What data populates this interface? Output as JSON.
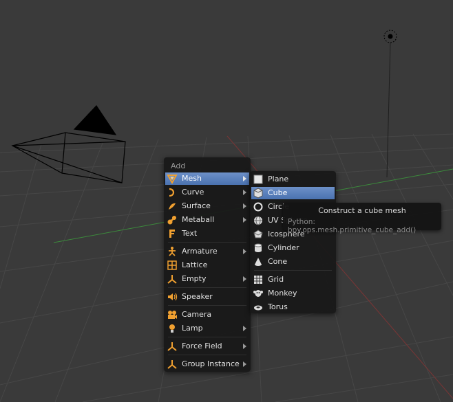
{
  "add_menu": {
    "title": "Add",
    "items": [
      {
        "label": "Mesh",
        "icon": "mesh-icon",
        "submenu": true,
        "active": true
      },
      {
        "label": "Curve",
        "icon": "curve-icon",
        "submenu": true
      },
      {
        "label": "Surface",
        "icon": "surface-icon",
        "submenu": true
      },
      {
        "label": "Metaball",
        "icon": "metaball-icon",
        "submenu": true
      },
      {
        "label": "Text",
        "icon": "text-icon",
        "submenu": false
      },
      {
        "label": "Armature",
        "icon": "armature-icon",
        "submenu": true
      },
      {
        "label": "Lattice",
        "icon": "lattice-icon",
        "submenu": false
      },
      {
        "label": "Empty",
        "icon": "empty-icon",
        "submenu": true
      },
      {
        "label": "Speaker",
        "icon": "speaker-icon",
        "submenu": false
      },
      {
        "label": "Camera",
        "icon": "camera-icon",
        "submenu": false
      },
      {
        "label": "Lamp",
        "icon": "lamp-icon",
        "submenu": true
      },
      {
        "label": "Force Field",
        "icon": "force-field-icon",
        "submenu": true
      },
      {
        "label": "Group Instance",
        "icon": "group-instance-icon",
        "submenu": true
      }
    ]
  },
  "mesh_menu": {
    "items": [
      {
        "label": "Plane",
        "icon": "plane-icon"
      },
      {
        "label": "Cube",
        "icon": "cube-icon",
        "active": true
      },
      {
        "label": "Circle",
        "icon": "circle-icon"
      },
      {
        "label": "UV Sphere",
        "icon": "uv-sphere-icon"
      },
      {
        "label": "Icosphere",
        "icon": "icosphere-icon"
      },
      {
        "label": "Cylinder",
        "icon": "cylinder-icon"
      },
      {
        "label": "Cone",
        "icon": "cone-icon"
      },
      {
        "label": "Grid",
        "icon": "grid-icon"
      },
      {
        "label": "Monkey",
        "icon": "monkey-icon"
      },
      {
        "label": "Torus",
        "icon": "torus-icon"
      }
    ]
  },
  "tooltip": {
    "title": "Construct a cube mesh",
    "python": "Python: bpy.ops.mesh.primitive_cube_add()"
  },
  "colors": {
    "background": "#3a3a3a",
    "grid": "#484848",
    "axis_x": "#8a3a3a",
    "axis_y": "#3f8a3f",
    "highlight": "#5680c2",
    "icon_orange": "#f0a030"
  }
}
